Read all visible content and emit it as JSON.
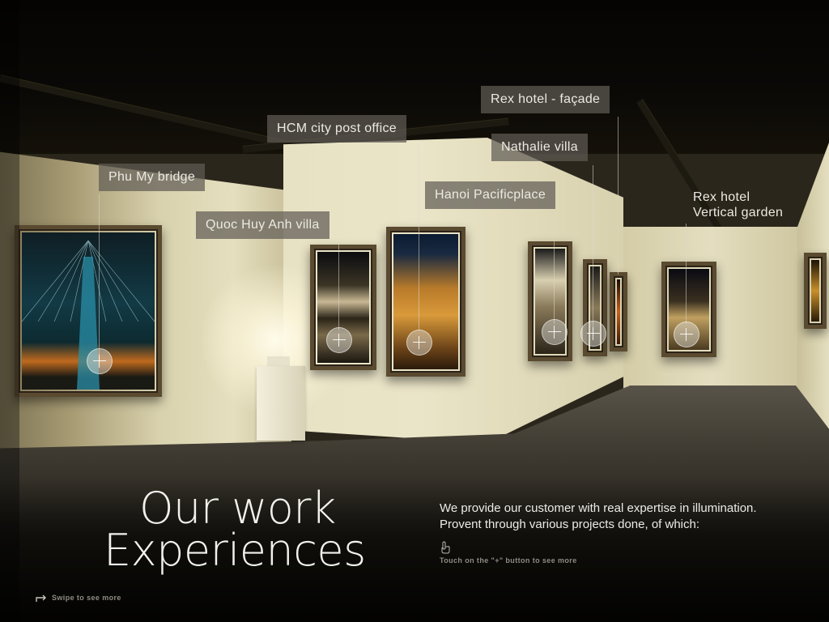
{
  "section": {
    "title_line1": "Our work",
    "title_line2": "Experiences",
    "description_line1": "We provide our customer with real expertise in illumination.",
    "description_line2": "Provent through various projects done, of which:",
    "touch_hint": "Touch on the \"+\" button to see more",
    "swipe_hint": "Swipe to see more"
  },
  "projects": [
    {
      "label": "Phu My bridge",
      "icon": "plus-icon"
    },
    {
      "label": "Quoc Huy Anh villa",
      "icon": "plus-icon"
    },
    {
      "label": "HCM city post office",
      "icon": "plus-icon"
    },
    {
      "label": "Hanoi Pacificplace",
      "icon": "plus-icon"
    },
    {
      "label": "Rex hotel - façade",
      "icon": "plus-icon"
    },
    {
      "label": "Nathalie villa",
      "icon": "plus-icon"
    },
    {
      "label": "Rex hotel",
      "label_line2": "Vertical garden",
      "icon": "plus-icon"
    }
  ],
  "colors": {
    "label_bg": "#5f5c55",
    "text": "#ecebe6",
    "hint": "#8e8b82"
  }
}
